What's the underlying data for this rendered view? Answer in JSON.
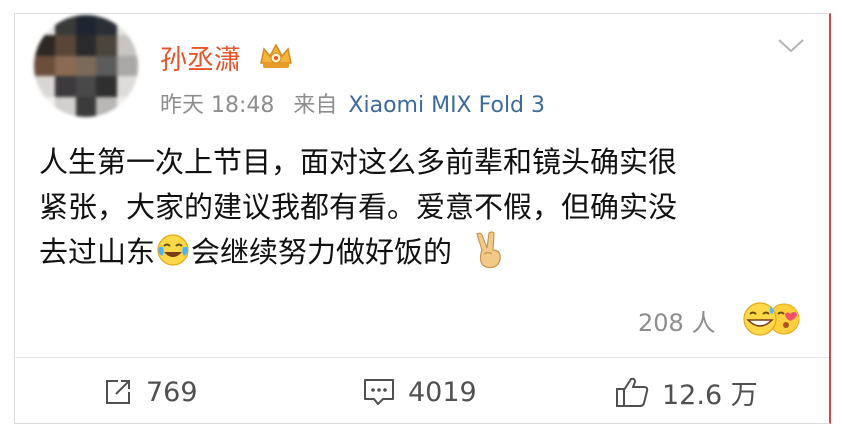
{
  "post": {
    "author": "孙丞潇",
    "author_badge_icon": "vip-crown-icon",
    "time": "昨天 18:48",
    "source_prefix": "来自",
    "source_device": "Xiaomi MIX Fold 3",
    "content_lines": [
      "人生第一次上节目，面对这么多前辈和镜头确实很",
      "紧张，大家的建议我都有看。爱意不假，但确实没",
      "去过山东"
    ],
    "content_line3_after_emoji": "会继续努力做好饭的",
    "inline_emojis": [
      "crying-laughing-emoji",
      "victory-hand-emoji"
    ]
  },
  "reactions": {
    "count": "208 人",
    "icons": [
      "grinning-sweat-emoji",
      "blowing-kiss-emoji"
    ]
  },
  "actions": {
    "repost_count": "769",
    "comment_count": "4019",
    "like_count": "12.6 万"
  },
  "colors": {
    "author": "#e8542a",
    "source_link": "#3d6a9c",
    "meta_gray": "#8d8d8d",
    "text": "#111111"
  }
}
